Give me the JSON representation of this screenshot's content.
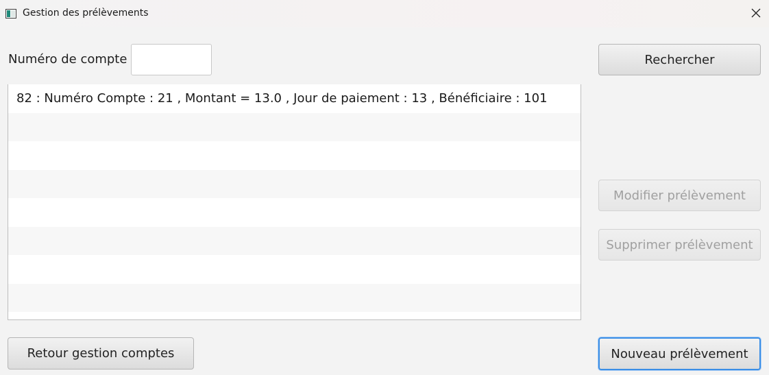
{
  "window": {
    "title": "Gestion des prélèvements",
    "app_icon": "window-app-icon",
    "close_icon": "close-icon"
  },
  "search": {
    "label": "Numéro de compte",
    "input_value": "",
    "placeholder": "",
    "button_label": "Rechercher"
  },
  "list": {
    "rows": [
      "82 : Numéro Compte : 21 , Montant = 13.0 , Jour de paiement : 13 , Bénéficiaire : 101",
      "",
      "",
      "",
      "",
      "",
      "",
      "",
      ""
    ]
  },
  "actions": {
    "modifier_label": "Modifier prélèvement",
    "supprimer_label": "Supprimer prélèvement",
    "retour_label": "Retour gestion comptes",
    "nouveau_label": "Nouveau prélèvement"
  },
  "colors": {
    "focus_border": "#3a8ee6",
    "disabled_text": "#a0a0a0",
    "window_bg": "#f3f3f3"
  }
}
